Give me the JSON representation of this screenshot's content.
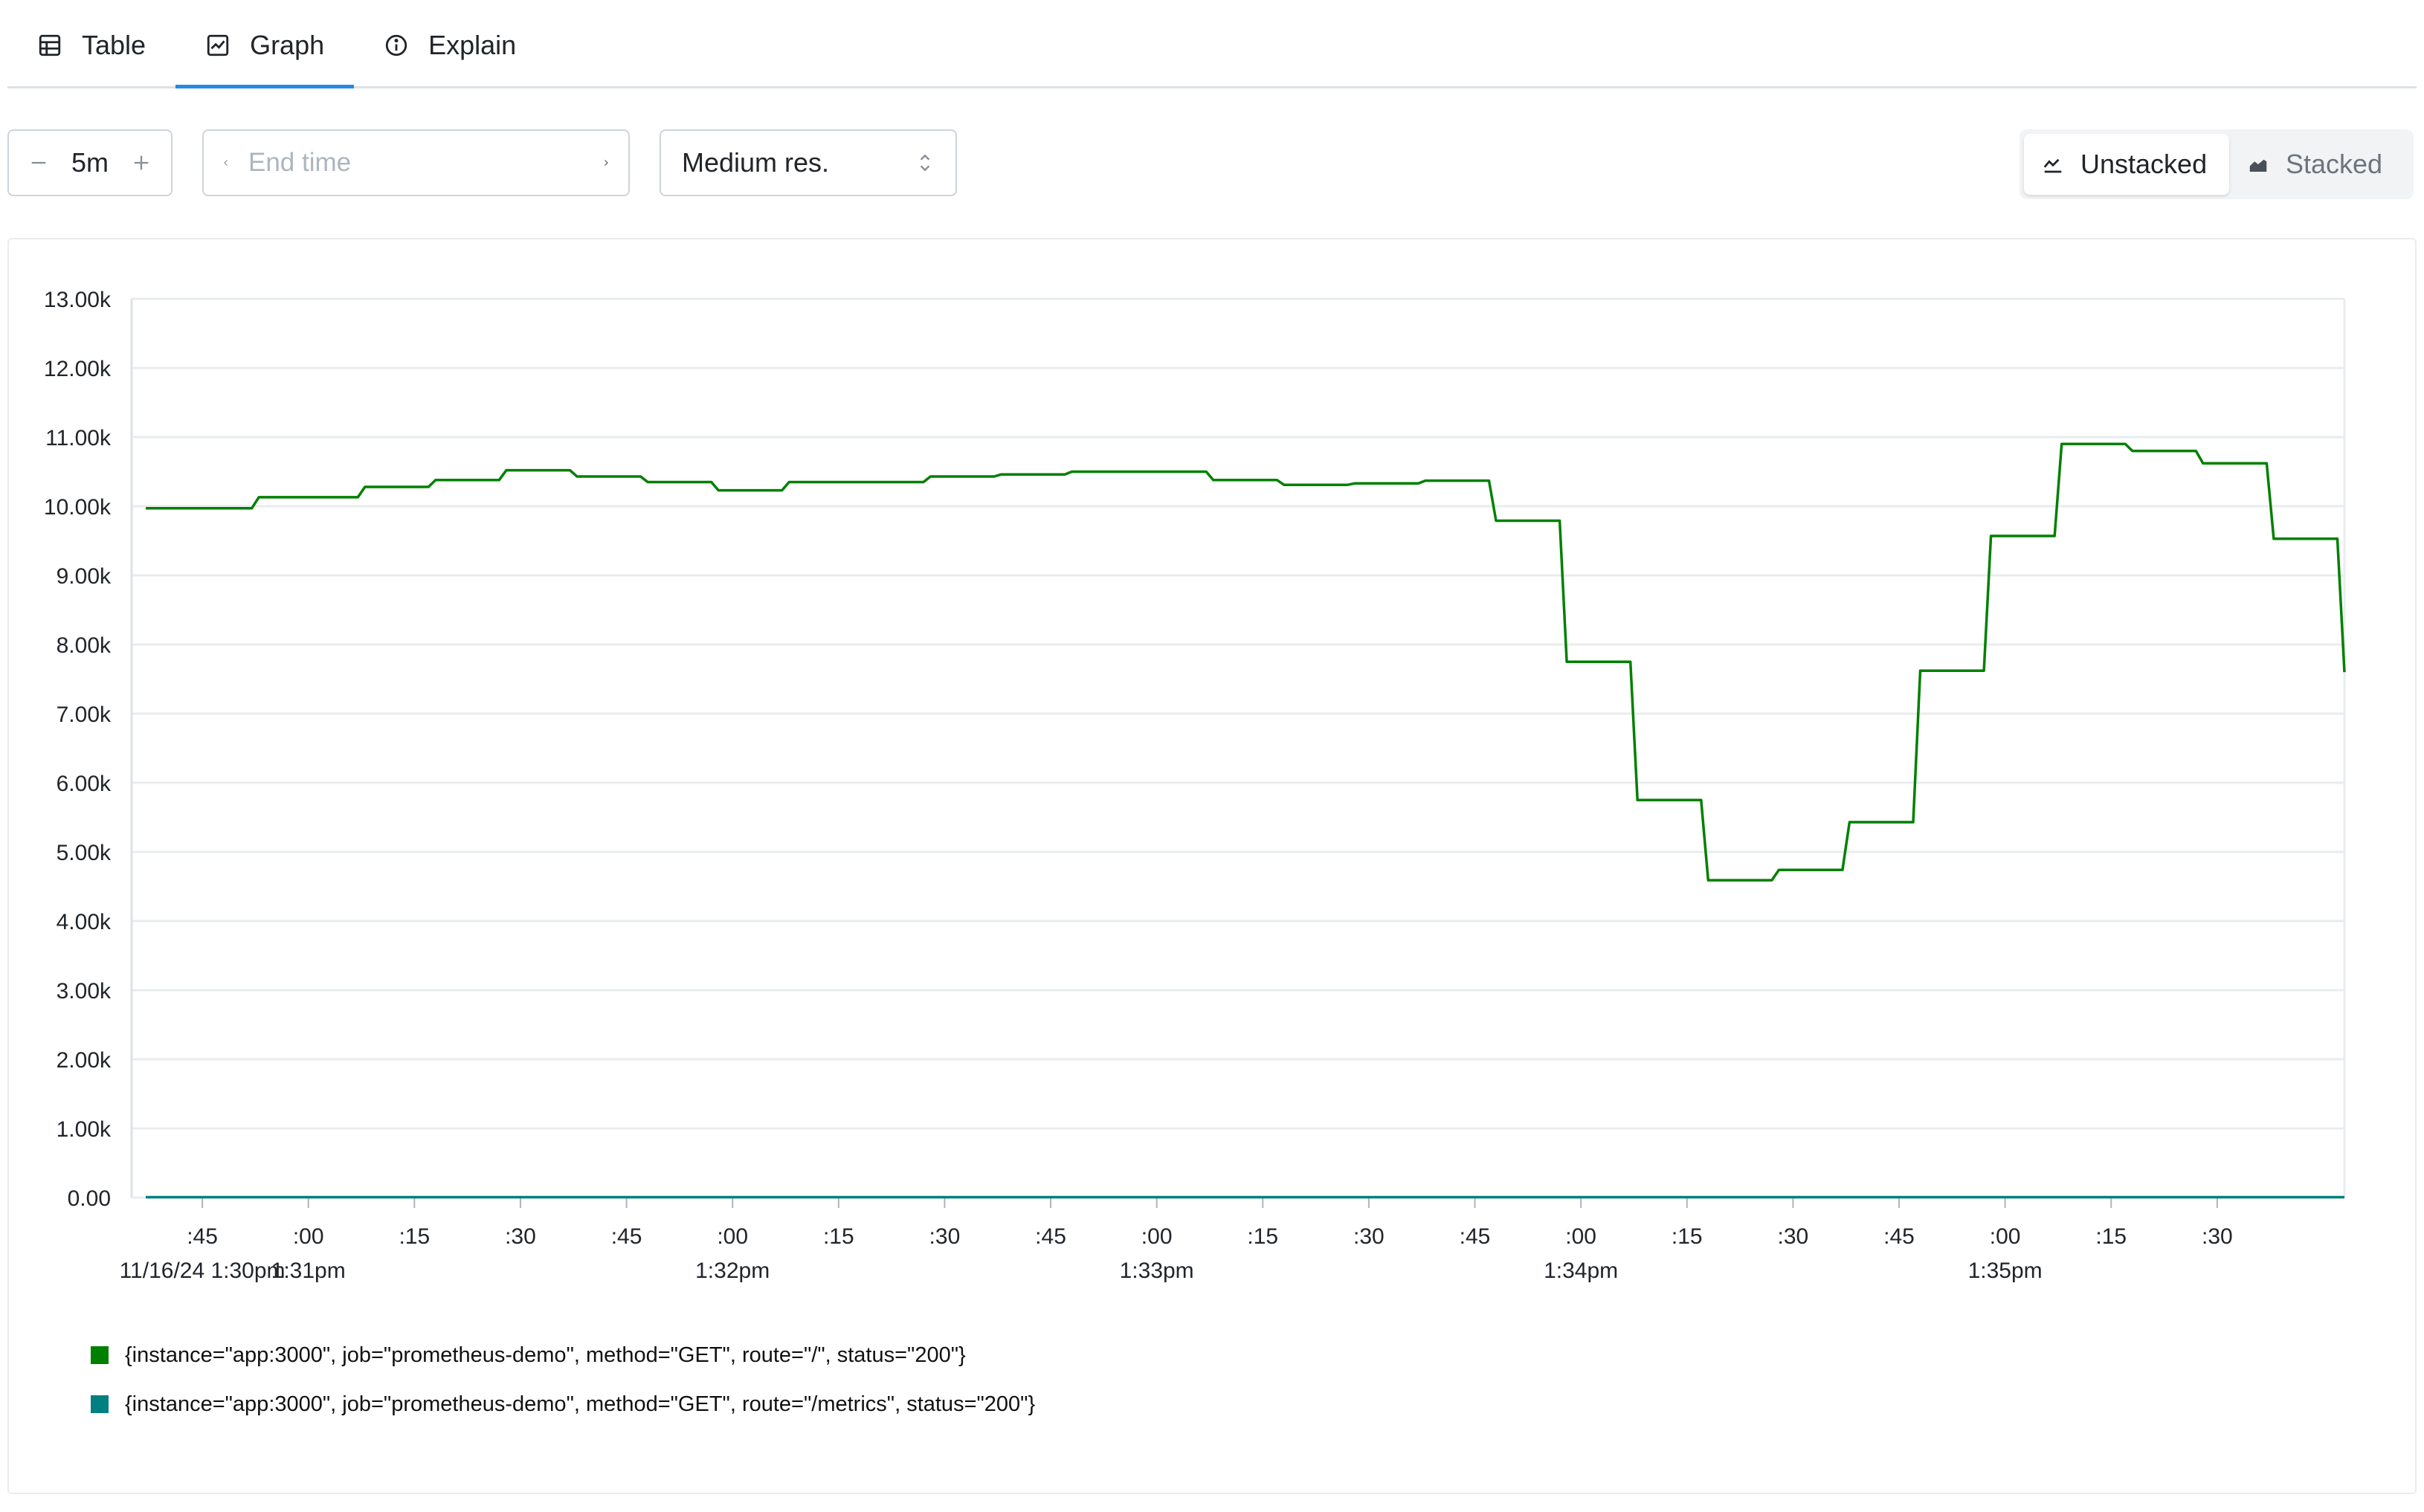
{
  "tabs": [
    {
      "label": "Table",
      "icon": "table-icon"
    },
    {
      "label": "Graph",
      "icon": "graph-icon",
      "active": true
    },
    {
      "label": "Explain",
      "icon": "info-icon"
    }
  ],
  "controls": {
    "range_value": "5m",
    "end_time_placeholder": "End time",
    "end_time_value": "",
    "resolution": "Medium res.",
    "stack_modes": [
      {
        "label": "Unstacked",
        "icon": "line-chart-icon",
        "active": true
      },
      {
        "label": "Stacked",
        "icon": "area-chart-icon",
        "active": false
      }
    ]
  },
  "colors": {
    "series_1": "#008000",
    "series_2": "#008080",
    "accent": "#228be6"
  },
  "chart_data": {
    "type": "line",
    "ylim": [
      0,
      13000
    ],
    "y_ticks": [
      {
        "value": 0,
        "label": "0.00"
      },
      {
        "value": 1000,
        "label": "1.00k"
      },
      {
        "value": 2000,
        "label": "2.00k"
      },
      {
        "value": 3000,
        "label": "3.00k"
      },
      {
        "value": 4000,
        "label": "4.00k"
      },
      {
        "value": 5000,
        "label": "5.00k"
      },
      {
        "value": 6000,
        "label": "6.00k"
      },
      {
        "value": 7000,
        "label": "7.00k"
      },
      {
        "value": 8000,
        "label": "8.00k"
      },
      {
        "value": 9000,
        "label": "9.00k"
      },
      {
        "value": 10000,
        "label": "10.00k"
      },
      {
        "value": 11000,
        "label": "11.00k"
      },
      {
        "value": 12000,
        "label": "12.00k"
      },
      {
        "value": 13000,
        "label": "13.00k"
      }
    ],
    "xlim": [
      "13:30:37",
      "13:35:37"
    ],
    "x_ticks": [
      {
        "time": "13:30:45",
        "label": ":45",
        "sublabel": "11/16/24 1:30pm"
      },
      {
        "time": "13:31:00",
        "label": ":00",
        "sublabel": "1:31pm"
      },
      {
        "time": "13:31:15",
        "label": ":15"
      },
      {
        "time": "13:31:30",
        "label": ":30"
      },
      {
        "time": "13:31:45",
        "label": ":45"
      },
      {
        "time": "13:32:00",
        "label": ":00",
        "sublabel": "1:32pm"
      },
      {
        "time": "13:32:15",
        "label": ":15"
      },
      {
        "time": "13:32:30",
        "label": ":30"
      },
      {
        "time": "13:32:45",
        "label": ":45"
      },
      {
        "time": "13:33:00",
        "label": ":00",
        "sublabel": "1:33pm"
      },
      {
        "time": "13:33:15",
        "label": ":15"
      },
      {
        "time": "13:33:30",
        "label": ":30"
      },
      {
        "time": "13:33:45",
        "label": ":45"
      },
      {
        "time": "13:34:00",
        "label": ":00",
        "sublabel": "1:34pm"
      },
      {
        "time": "13:34:15",
        "label": ":15"
      },
      {
        "time": "13:34:30",
        "label": ":30"
      },
      {
        "time": "13:34:45",
        "label": ":45"
      },
      {
        "time": "13:35:00",
        "label": ":00",
        "sublabel": "1:35pm"
      },
      {
        "time": "13:35:15",
        "label": ":15"
      },
      {
        "time": "13:35:30",
        "label": ":30"
      }
    ],
    "series": [
      {
        "name": "{instance=\"app:3000\", job=\"prometheus-demo\", method=\"GET\", route=\"/\", status=\"200\"}",
        "color": "#008000",
        "points": [
          [
            "13:30:37",
            9970
          ],
          [
            "13:30:45",
            9970
          ],
          [
            "13:30:52",
            9970
          ],
          [
            "13:30:53",
            10130
          ],
          [
            "13:30:59",
            10130
          ],
          [
            "13:31:00",
            10130
          ],
          [
            "13:31:07",
            10130
          ],
          [
            "13:31:08",
            10280
          ],
          [
            "13:31:15",
            10280
          ],
          [
            "13:31:17",
            10280
          ],
          [
            "13:31:18",
            10380
          ],
          [
            "13:31:23",
            10380
          ],
          [
            "13:31:25",
            10380
          ],
          [
            "13:31:27",
            10380
          ],
          [
            "13:31:28",
            10520
          ],
          [
            "13:31:32",
            10520
          ],
          [
            "13:31:37",
            10520
          ],
          [
            "13:31:38",
            10430
          ],
          [
            "13:31:45",
            10430
          ],
          [
            "13:31:47",
            10430
          ],
          [
            "13:31:48",
            10350
          ],
          [
            "13:31:55",
            10350
          ],
          [
            "13:31:57",
            10350
          ],
          [
            "13:31:58",
            10230
          ],
          [
            "13:32:05",
            10230
          ],
          [
            "13:32:07",
            10230
          ],
          [
            "13:32:08",
            10350
          ],
          [
            "13:32:15",
            10350
          ],
          [
            "13:32:25",
            10350
          ],
          [
            "13:32:27",
            10350
          ],
          [
            "13:32:28",
            10430
          ],
          [
            "13:32:35",
            10430
          ],
          [
            "13:32:37",
            10430
          ],
          [
            "13:32:38",
            10460
          ],
          [
            "13:32:45",
            10460
          ],
          [
            "13:32:47",
            10460
          ],
          [
            "13:32:48",
            10500
          ],
          [
            "13:33:05",
            10500
          ],
          [
            "13:33:07",
            10500
          ],
          [
            "13:33:08",
            10380
          ],
          [
            "13:33:15",
            10380
          ],
          [
            "13:33:17",
            10380
          ],
          [
            "13:33:18",
            10310
          ],
          [
            "13:33:25",
            10310
          ],
          [
            "13:33:27",
            10310
          ],
          [
            "13:33:28",
            10330
          ],
          [
            "13:33:35",
            10330
          ],
          [
            "13:33:37",
            10330
          ],
          [
            "13:33:38",
            10370
          ],
          [
            "13:33:47",
            10370
          ],
          [
            "13:33:48",
            9790
          ],
          [
            "13:33:57",
            9790
          ],
          [
            "13:33:58",
            7750
          ],
          [
            "13:34:07",
            7750
          ],
          [
            "13:34:08",
            5750
          ],
          [
            "13:34:17",
            5750
          ],
          [
            "13:34:18",
            4590
          ],
          [
            "13:34:27",
            4590
          ],
          [
            "13:34:28",
            4740
          ],
          [
            "13:34:37",
            4740
          ],
          [
            "13:34:38",
            5430
          ],
          [
            "13:34:47",
            5430
          ],
          [
            "13:34:48",
            7620
          ],
          [
            "13:34:57",
            7620
          ],
          [
            "13:34:58",
            9570
          ],
          [
            "13:35:07",
            9570
          ],
          [
            "13:35:08",
            10900
          ],
          [
            "13:35:17",
            10900
          ],
          [
            "13:35:18",
            10800
          ],
          [
            "13:35:27",
            10800
          ],
          [
            "13:35:28",
            10620
          ],
          [
            "13:35:37",
            10620
          ],
          [
            "13:35:38",
            9530
          ],
          [
            "13:35:47",
            9530
          ],
          [
            "13:35:48",
            7600
          ]
        ]
      },
      {
        "name": "{instance=\"app:3000\", job=\"prometheus-demo\", method=\"GET\", route=\"/metrics\", status=\"200\"}",
        "color": "#008080",
        "points": [
          [
            "13:30:37",
            5
          ],
          [
            "13:35:48",
            5
          ]
        ]
      }
    ],
    "grid": true,
    "legend_position": "bottom-left"
  }
}
